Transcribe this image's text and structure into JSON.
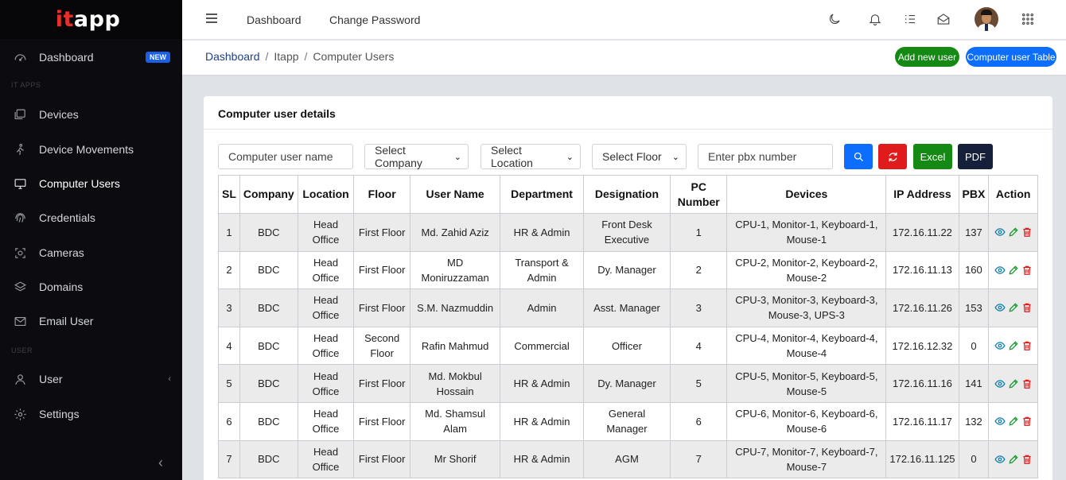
{
  "brand": {
    "name": "itapp",
    "prefix": "it",
    "suffix": "app"
  },
  "sidebar": {
    "items": [
      {
        "label": "Dashboard",
        "icon": "dashboard-gauge-icon",
        "badge": "NEW"
      },
      {
        "label": "Devices",
        "icon": "devices-icon"
      },
      {
        "label": "Device Movements",
        "icon": "walking-person-icon"
      },
      {
        "label": "Computer Users",
        "icon": "monitor-icon",
        "active": true
      },
      {
        "label": "Credentials",
        "icon": "fingerprint-icon"
      },
      {
        "label": "Cameras",
        "icon": "camera-icon"
      },
      {
        "label": "Domains",
        "icon": "layers-icon"
      },
      {
        "label": "Email User",
        "icon": "mail-icon"
      },
      {
        "label": "User",
        "icon": "user-icon"
      },
      {
        "label": "Settings",
        "icon": "gear-icon"
      }
    ],
    "sections": {
      "apps": "IT APPS",
      "user": "USER"
    }
  },
  "topbar": {
    "links": [
      "Dashboard",
      "Change Password"
    ],
    "icons": [
      "menu-icon",
      "moon-icon",
      "bell-icon",
      "checklist-icon",
      "mail-open-icon",
      "avatar",
      "apps-grid-icon"
    ]
  },
  "breadcrumb": {
    "items": [
      "Dashboard",
      "Itapp",
      "Computer Users"
    ],
    "separator": "/"
  },
  "header_buttons": {
    "add_user": "Add new user",
    "table": "Computer user Table"
  },
  "card": {
    "title": "Computer user details"
  },
  "filters": {
    "name_placeholder": "Computer user name",
    "company": "Select Company",
    "location": "Select Location",
    "floor": "Select Floor",
    "pbx_placeholder": "Enter pbx number",
    "excel": "Excel",
    "pdf": "PDF"
  },
  "colors": {
    "sidebar_bg": "#0c0c10",
    "brand_red": "#e8302b",
    "primary": "#0d6efd",
    "success": "#148a14",
    "danger": "#e01b1b",
    "dark": "#17203a"
  },
  "table": {
    "headers": [
      "SL",
      "Company",
      "Location",
      "Floor",
      "User Name",
      "Department",
      "Designation",
      "PC Number",
      "Devices",
      "IP Address",
      "PBX",
      "Action"
    ],
    "rows": [
      [
        "1",
        "BDC",
        "Head Office",
        "First Floor",
        "Md. Zahid Aziz",
        "HR & Admin",
        "Front Desk Executive",
        "1",
        "CPU-1, Monitor-1, Keyboard-1, Mouse-1",
        "172.16.11.22",
        "137"
      ],
      [
        "2",
        "BDC",
        "Head Office",
        "First Floor",
        "MD Moniruzzaman",
        "Transport & Admin",
        "Dy. Manager",
        "2",
        "CPU-2, Monitor-2, Keyboard-2, Mouse-2",
        "172.16.11.13",
        "160"
      ],
      [
        "3",
        "BDC",
        "Head Office",
        "First Floor",
        "S.M. Nazmuddin",
        "Admin",
        "Asst. Manager",
        "3",
        "CPU-3, Monitor-3, Keyboard-3, Mouse-3, UPS-3",
        "172.16.11.26",
        "153"
      ],
      [
        "4",
        "BDC",
        "Head Office",
        "Second Floor",
        "Rafin Mahmud",
        "Commercial",
        "Officer",
        "4",
        "CPU-4, Monitor-4, Keyboard-4, Mouse-4",
        "172.16.12.32",
        "0"
      ],
      [
        "5",
        "BDC",
        "Head Office",
        "First Floor",
        "Md. Mokbul Hossain",
        "HR & Admin",
        "Dy. Manager",
        "5",
        "CPU-5, Monitor-5, Keyboard-5, Mouse-5",
        "172.16.11.16",
        "141"
      ],
      [
        "6",
        "BDC",
        "Head Office",
        "First Floor",
        "Md. Shamsul Alam",
        "HR & Admin",
        "General Manager",
        "6",
        "CPU-6, Monitor-6, Keyboard-6, Mouse-6",
        "172.16.11.17",
        "132"
      ],
      [
        "7",
        "BDC",
        "Head Office",
        "First Floor",
        "Mr Shorif",
        "HR & Admin",
        "AGM",
        "7",
        "CPU-7, Monitor-7, Keyboard-7, Mouse-7",
        "172.16.11.125",
        "0"
      ]
    ],
    "actions": [
      "view-icon",
      "edit-icon",
      "delete-icon"
    ]
  }
}
